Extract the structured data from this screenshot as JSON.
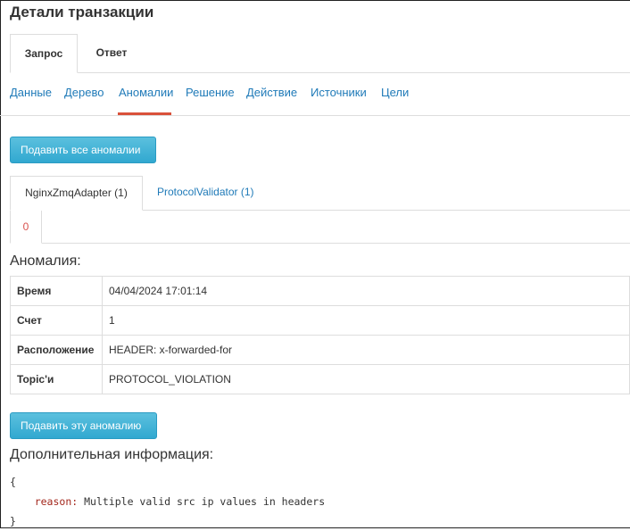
{
  "page": {
    "title": "Детали транзакции"
  },
  "main_tabs": [
    {
      "label": "Запрос",
      "active": true
    },
    {
      "label": "Ответ",
      "active": false
    }
  ],
  "sub_nav": [
    {
      "label": "Данные"
    },
    {
      "label": "Дерево"
    },
    {
      "label": "Аномалии",
      "active": true
    },
    {
      "label": "Решение"
    },
    {
      "label": "Действие"
    },
    {
      "label": "Источники"
    },
    {
      "label": "Цели"
    }
  ],
  "buttons": {
    "suppress_all": "Подавить все аномалии",
    "suppress_one": "Подавить эту аномалию"
  },
  "detector_tabs": [
    {
      "label": "NginxZmqAdapter (1)",
      "active": true
    },
    {
      "label": "ProtocolValidator (1)",
      "active": false
    }
  ],
  "index_tabs": [
    {
      "label": "0",
      "active": true
    }
  ],
  "anomaly": {
    "heading": "Аномалия:",
    "rows": [
      {
        "key": "Время",
        "value": "04/04/2024 17:01:14"
      },
      {
        "key": "Счет",
        "value": "1"
      },
      {
        "key": "Расположение",
        "value": "HEADER: x-forwarded-for"
      },
      {
        "key": "Topic'и",
        "value": "PROTOCOL_VIOLATION"
      }
    ]
  },
  "extra": {
    "heading": "Дополнительная информация:",
    "open_brace": "{",
    "key": "reason:",
    "value": "Multiple valid src ip values in headers",
    "close_brace": "}"
  },
  "colors": {
    "link": "#1f7ab8",
    "active_underline": "#d9513a",
    "button": "#5bc0de",
    "index_tab": "#d9534f",
    "code_key": "#a3271c"
  }
}
